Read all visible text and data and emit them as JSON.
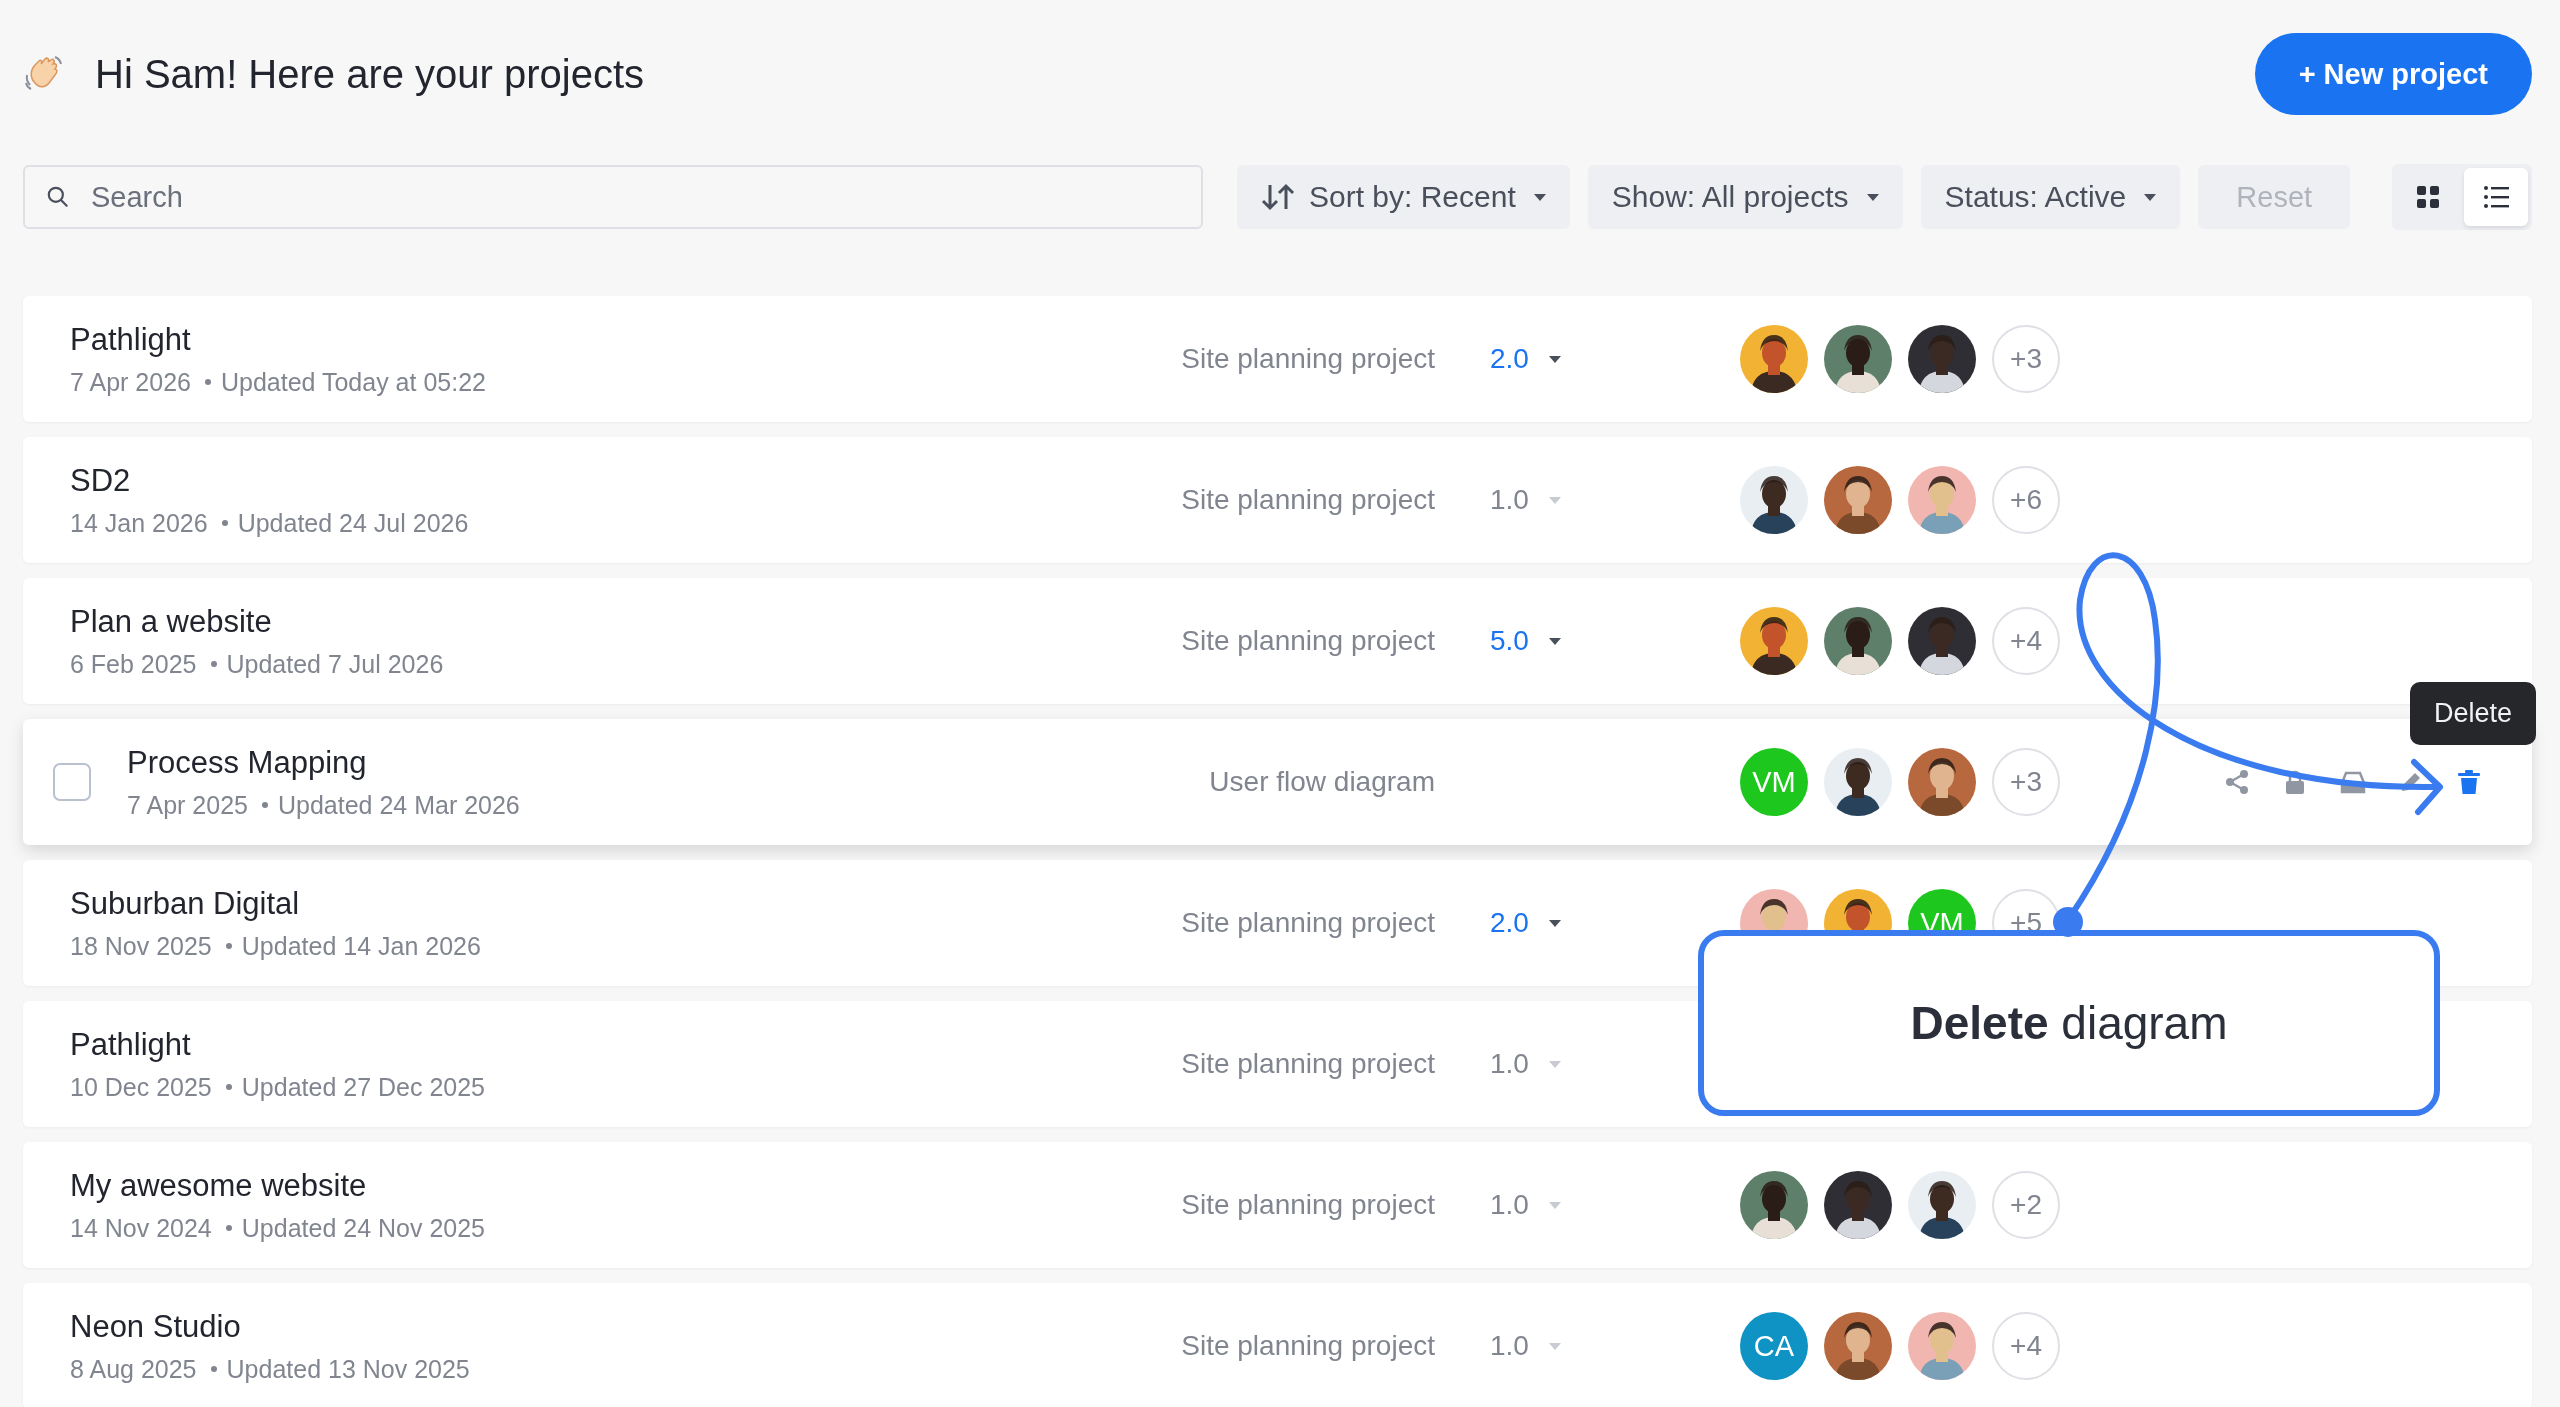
{
  "header": {
    "title": "Hi Sam! Here are your projects",
    "new_button": "+ New project"
  },
  "toolbar": {
    "search": {
      "placeholder": "Search"
    },
    "sort": "Sort by: Recent",
    "show": "Show: All projects",
    "status": "Status: Active",
    "reset": {
      "label": "Reset",
      "disabled": true
    },
    "views": [
      {
        "kind": "grid",
        "selected": false
      },
      {
        "kind": "list",
        "selected": true
      }
    ]
  },
  "projects": [
    {
      "name": "Pathlight",
      "created": "7 Apr 2026",
      "updated": "Updated Today at 05:22",
      "type": "Site planning project",
      "version": "2.0",
      "active": true,
      "hovered": false,
      "avatars": [
        {
          "kind": "picture"
        },
        {
          "kind": "picture"
        },
        {
          "kind": "picture"
        }
      ],
      "more": "+3"
    },
    {
      "name": "SD2",
      "created": "14 Jan 2026",
      "updated": "Updated 24 Jul 2026",
      "type": "Site planning project",
      "version": "1.0",
      "active": false,
      "hovered": false,
      "avatars": [
        {
          "kind": "picture"
        },
        {
          "kind": "picture"
        },
        {
          "kind": "picture"
        }
      ],
      "more": "+6"
    },
    {
      "name": "Plan a website",
      "created": "6 Feb 2025",
      "updated": "Updated 7 Jul 2026",
      "type": "Site planning project",
      "version": "5.0",
      "active": true,
      "hovered": false,
      "avatars": [
        {
          "kind": "picture"
        },
        {
          "kind": "picture"
        },
        {
          "kind": "picture"
        }
      ],
      "more": "+4"
    },
    {
      "name": "Process Mapping",
      "created": "7 Apr 2025",
      "updated": "Updated 24 Mar 2026",
      "type": "User flow diagram",
      "hovered": true,
      "checked": false,
      "avatars": [
        {
          "kind": "initials",
          "initials": "VM",
          "color": "#1ec71e"
        },
        {
          "kind": "picture"
        },
        {
          "kind": "picture"
        }
      ],
      "more": "+3",
      "actions": [
        {
          "kind": "share"
        },
        {
          "kind": "lock"
        },
        {
          "kind": "archive"
        },
        {
          "kind": "edit"
        },
        {
          "kind": "delete",
          "tooltip": "Delete"
        }
      ]
    },
    {
      "name": "Suburban Digital",
      "created": "18 Nov 2025",
      "updated": "Updated 14 Jan 2026",
      "type": "Site planning project",
      "version": "2.0",
      "active": true,
      "hovered": false,
      "avatars": [
        {
          "kind": "picture"
        },
        {
          "kind": "picture"
        },
        {
          "kind": "initials",
          "initials": "VM",
          "color": "#1ec71e"
        }
      ],
      "more": "+5"
    },
    {
      "name": "Pathlight",
      "created": "10 Dec 2025",
      "updated": "Updated 27 Dec 2025",
      "type": "Site planning project",
      "version": "1.0",
      "active": false,
      "hovered": false
    },
    {
      "name": "My awesome website",
      "created": "14 Nov 2024",
      "updated": "Updated 24 Nov 2025",
      "type": "Site planning project",
      "version": "1.0",
      "active": false,
      "hovered": false,
      "avatars": [
        {
          "kind": "picture"
        },
        {
          "kind": "picture"
        },
        {
          "kind": "picture"
        }
      ],
      "more": "+2"
    },
    {
      "name": "Neon Studio",
      "created": "8 Aug 2025",
      "updated": "Updated 13 Nov 2025",
      "type": "Site planning project",
      "version": "1.0",
      "active": false,
      "hovered": false,
      "avatars": [
        {
          "kind": "initials",
          "initials": "CA",
          "color": "#0f93c4"
        },
        {
          "kind": "picture"
        },
        {
          "kind": "picture"
        }
      ],
      "more": "+4"
    }
  ],
  "callout": {
    "text": "**Delete** diagram"
  }
}
